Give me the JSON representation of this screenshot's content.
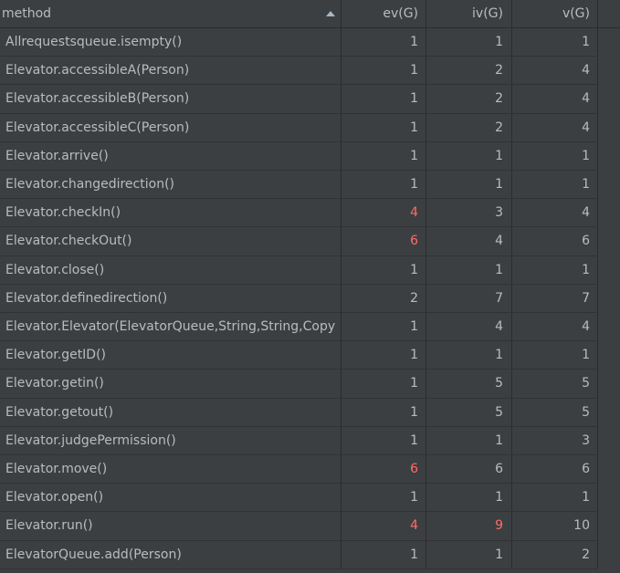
{
  "header": {
    "col_method": "method",
    "col_ev": "ev(G)",
    "col_iv": "iv(G)",
    "col_v": "v(G)"
  },
  "rows": [
    {
      "method": "Allrequestsqueue.isempty()",
      "ev": "1",
      "iv": "1",
      "v": "1"
    },
    {
      "method": "Elevator.accessibleA(Person)",
      "ev": "1",
      "iv": "2",
      "v": "4"
    },
    {
      "method": "Elevator.accessibleB(Person)",
      "ev": "1",
      "iv": "2",
      "v": "4"
    },
    {
      "method": "Elevator.accessibleC(Person)",
      "ev": "1",
      "iv": "2",
      "v": "4"
    },
    {
      "method": "Elevator.arrive()",
      "ev": "1",
      "iv": "1",
      "v": "1"
    },
    {
      "method": "Elevator.changedirection()",
      "ev": "1",
      "iv": "1",
      "v": "1"
    },
    {
      "method": "Elevator.checkIn()",
      "ev": "4",
      "iv": "3",
      "v": "4"
    },
    {
      "method": "Elevator.checkOut()",
      "ev": "6",
      "iv": "4",
      "v": "6"
    },
    {
      "method": "Elevator.close()",
      "ev": "1",
      "iv": "1",
      "v": "1"
    },
    {
      "method": "Elevator.definedirection()",
      "ev": "2",
      "iv": "7",
      "v": "7"
    },
    {
      "method": "Elevator.Elevator(ElevatorQueue,String,String,Copy",
      "ev": "1",
      "iv": "4",
      "v": "4"
    },
    {
      "method": "Elevator.getID()",
      "ev": "1",
      "iv": "1",
      "v": "1"
    },
    {
      "method": "Elevator.getin()",
      "ev": "1",
      "iv": "5",
      "v": "5"
    },
    {
      "method": "Elevator.getout()",
      "ev": "1",
      "iv": "5",
      "v": "5"
    },
    {
      "method": "Elevator.judgePermission()",
      "ev": "1",
      "iv": "1",
      "v": "3"
    },
    {
      "method": "Elevator.move()",
      "ev": "6",
      "iv": "6",
      "v": "6"
    },
    {
      "method": "Elevator.open()",
      "ev": "1",
      "iv": "1",
      "v": "1"
    },
    {
      "method": "Elevator.run()",
      "ev": "4",
      "iv": "9",
      "v": "10"
    },
    {
      "method": "ElevatorQueue.add(Person)",
      "ev": "1",
      "iv": "1",
      "v": "2"
    }
  ],
  "highlight_color": "#ff6b68",
  "highlighted": {
    "6": [
      "ev"
    ],
    "7": [
      "ev"
    ],
    "15": [
      "ev"
    ],
    "17": [
      "ev",
      "iv"
    ]
  },
  "icons": {
    "sort": "sort-ascending-icon"
  }
}
